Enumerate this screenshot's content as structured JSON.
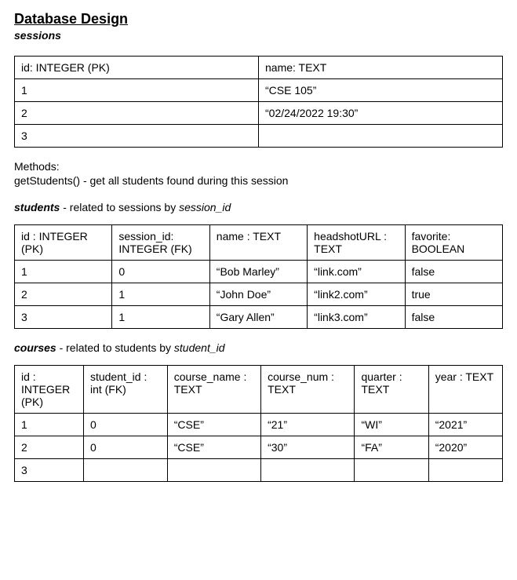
{
  "title": "Database Design",
  "sessions": {
    "label": "sessions",
    "headers": {
      "id": "id: INTEGER (PK)",
      "name": "name: TEXT"
    },
    "rows": [
      {
        "id": "1",
        "name": "“CSE 105”"
      },
      {
        "id": "2",
        "name": "“02/24/2022 19:30”"
      },
      {
        "id": "3",
        "name": ""
      }
    ]
  },
  "methods": {
    "label": "Methods:",
    "body": "getStudents() - get all students found during this session"
  },
  "students": {
    "label_name": "students",
    "label_rest": " - related to sessions by ",
    "label_key": "session_id",
    "headers": {
      "id": "id : INTEGER (PK)",
      "session_id": "session_id: INTEGER (FK)",
      "name": "name : TEXT",
      "headshot": "headshotURL : TEXT",
      "favorite": "favorite: BOOLEAN"
    },
    "rows": [
      {
        "id": "1",
        "session_id": "0",
        "name": "“Bob Marley”",
        "headshot": "“link.com”",
        "favorite": "false"
      },
      {
        "id": "2",
        "session_id": "1",
        "name": "“John Doe”",
        "headshot": "“link2.com”",
        "favorite": "true"
      },
      {
        "id": "3",
        "session_id": "1",
        "name": "“Gary Allen”",
        "headshot": "“link3.com”",
        "favorite": "false"
      }
    ]
  },
  "courses": {
    "label_name": "courses",
    "label_rest": " - related to students by ",
    "label_key": "student_id",
    "headers": {
      "id": "id : INTEGER (PK)",
      "student_id": "student_id : int (FK)",
      "course_name": "course_name : TEXT",
      "course_num": "course_num : TEXT",
      "quarter": "quarter : TEXT",
      "year": "year : TEXT"
    },
    "rows": [
      {
        "id": "1",
        "student_id": "0",
        "course_name": "“CSE”",
        "course_num": "“21”",
        "quarter": "“WI”",
        "year": "“2021”"
      },
      {
        "id": "2",
        "student_id": "0",
        "course_name": "“CSE”",
        "course_num": "“30”",
        "quarter": "“FA”",
        "year": "“2020”"
      },
      {
        "id": "3",
        "student_id": "",
        "course_name": "",
        "course_num": "",
        "quarter": "",
        "year": ""
      }
    ]
  }
}
